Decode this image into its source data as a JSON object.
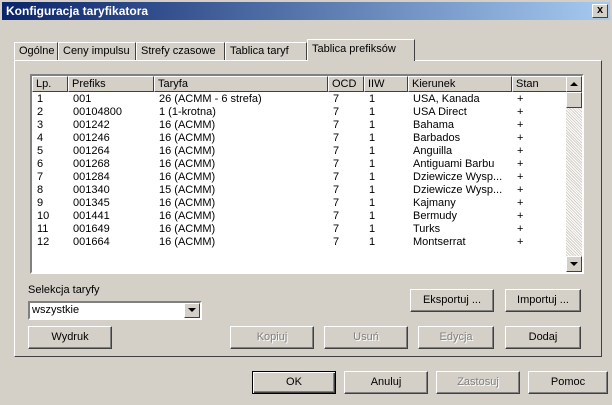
{
  "window": {
    "title": "Konfiguracja taryfikatora",
    "close_label": "x"
  },
  "tabs": [
    {
      "label": "Ogólne"
    },
    {
      "label": "Ceny impulsu"
    },
    {
      "label": "Strefy czasowe"
    },
    {
      "label": "Tablica taryf"
    },
    {
      "label": "Tablica prefiksów",
      "active": true
    }
  ],
  "table": {
    "columns": [
      "Lp.",
      "Prefiks",
      "Taryfa",
      "OCD",
      "IIW",
      "Kierunek",
      "Stan"
    ],
    "rows": [
      [
        "1",
        "001",
        "26 (ACMM - 6 strefa)",
        "7",
        "1",
        "USA, Kanada",
        "+"
      ],
      [
        "2",
        "00104800",
        "1 (1-krotna)",
        "7",
        "1",
        "USA Direct",
        "+"
      ],
      [
        "3",
        "001242",
        "16 (ACMM)",
        "7",
        "1",
        "Bahama",
        "+"
      ],
      [
        "4",
        "001246",
        "16 (ACMM)",
        "7",
        "1",
        "Barbados",
        "+"
      ],
      [
        "5",
        "001264",
        "16 (ACMM)",
        "7",
        "1",
        "Anguilla",
        "+"
      ],
      [
        "6",
        "001268",
        "16 (ACMM)",
        "7",
        "1",
        "Antiguami Barbu",
        "+"
      ],
      [
        "7",
        "001284",
        "16 (ACMM)",
        "7",
        "1",
        "Dziewicze Wysp...",
        "+"
      ],
      [
        "8",
        "001340",
        "15 (ACMM)",
        "7",
        "1",
        "Dziewicze Wysp...",
        "+"
      ],
      [
        "9",
        "001345",
        "16 (ACMM)",
        "7",
        "1",
        "Kajmany",
        "+"
      ],
      [
        "10",
        "001441",
        "16 (ACMM)",
        "7",
        "1",
        "Bermudy",
        "+"
      ],
      [
        "11",
        "001649",
        "16 (ACMM)",
        "7",
        "1",
        "Turks",
        "+"
      ],
      [
        "12",
        "001664",
        "16 (ACMM)",
        "7",
        "1",
        "Montserrat",
        "+"
      ]
    ]
  },
  "selection": {
    "label": "Selekcja taryfy",
    "value": "wszystkie"
  },
  "buttons": {
    "export": "Eksportuj ...",
    "import": "Importuj ...",
    "print": "Wydruk",
    "copy": "Kopiuj",
    "delete": "Usuń",
    "edit": "Edycja",
    "add": "Dodaj",
    "ok": "OK",
    "cancel": "Anuluj",
    "apply": "Zastosuj",
    "help": "Pomoc"
  }
}
